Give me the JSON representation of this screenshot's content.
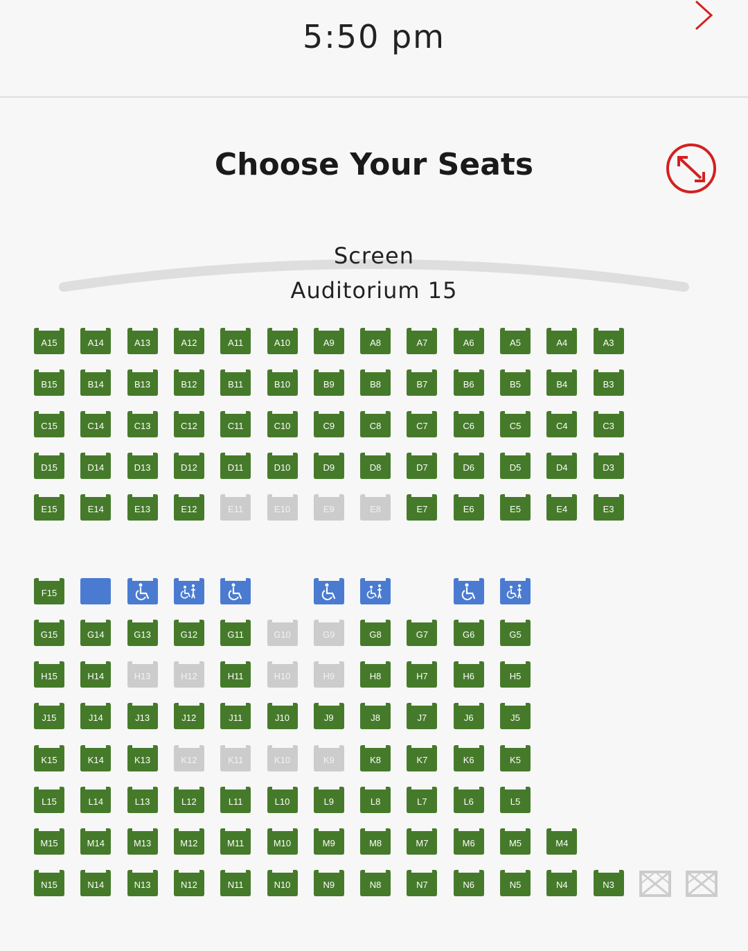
{
  "header": {
    "time": "5:50 pm",
    "next_icon": "chevron-right-icon"
  },
  "page": {
    "title": "Choose Your Seats",
    "expand_icon": "expand-icon",
    "screen_label": "Screen",
    "auditorium": "Auditorium 15"
  },
  "colors": {
    "available": "#457a2a",
    "unavailable": "#cccccc",
    "accessible": "#4a7bd0",
    "accent": "#d42020"
  },
  "rows": [
    {
      "row": "A",
      "seats": [
        {
          "label": "A15",
          "status": "available"
        },
        {
          "label": "A14",
          "status": "available"
        },
        {
          "label": "A13",
          "status": "available"
        },
        {
          "label": "A12",
          "status": "available"
        },
        {
          "label": "A11",
          "status": "available"
        },
        {
          "label": "A10",
          "status": "available"
        },
        {
          "label": "A9",
          "status": "available"
        },
        {
          "label": "A8",
          "status": "available"
        },
        {
          "label": "A7",
          "status": "available"
        },
        {
          "label": "A6",
          "status": "available"
        },
        {
          "label": "A5",
          "status": "available"
        },
        {
          "label": "A4",
          "status": "available"
        },
        {
          "label": "A3",
          "status": "available"
        }
      ]
    },
    {
      "row": "B",
      "seats": [
        {
          "label": "B15",
          "status": "available"
        },
        {
          "label": "B14",
          "status": "available"
        },
        {
          "label": "B13",
          "status": "available"
        },
        {
          "label": "B12",
          "status": "available"
        },
        {
          "label": "B11",
          "status": "available"
        },
        {
          "label": "B10",
          "status": "available"
        },
        {
          "label": "B9",
          "status": "available"
        },
        {
          "label": "B8",
          "status": "available"
        },
        {
          "label": "B7",
          "status": "available"
        },
        {
          "label": "B6",
          "status": "available"
        },
        {
          "label": "B5",
          "status": "available"
        },
        {
          "label": "B4",
          "status": "available"
        },
        {
          "label": "B3",
          "status": "available"
        }
      ]
    },
    {
      "row": "C",
      "seats": [
        {
          "label": "C15",
          "status": "available"
        },
        {
          "label": "C14",
          "status": "available"
        },
        {
          "label": "C13",
          "status": "available"
        },
        {
          "label": "C12",
          "status": "available"
        },
        {
          "label": "C11",
          "status": "available"
        },
        {
          "label": "C10",
          "status": "available"
        },
        {
          "label": "C9",
          "status": "available"
        },
        {
          "label": "C8",
          "status": "available"
        },
        {
          "label": "C7",
          "status": "available"
        },
        {
          "label": "C6",
          "status": "available"
        },
        {
          "label": "C5",
          "status": "available"
        },
        {
          "label": "C4",
          "status": "available"
        },
        {
          "label": "C3",
          "status": "available"
        }
      ]
    },
    {
      "row": "D",
      "seats": [
        {
          "label": "D15",
          "status": "available"
        },
        {
          "label": "D14",
          "status": "available"
        },
        {
          "label": "D13",
          "status": "available"
        },
        {
          "label": "D12",
          "status": "available"
        },
        {
          "label": "D11",
          "status": "available"
        },
        {
          "label": "D10",
          "status": "available"
        },
        {
          "label": "D9",
          "status": "available"
        },
        {
          "label": "D8",
          "status": "available"
        },
        {
          "label": "D7",
          "status": "available"
        },
        {
          "label": "D6",
          "status": "available"
        },
        {
          "label": "D5",
          "status": "available"
        },
        {
          "label": "D4",
          "status": "available"
        },
        {
          "label": "D3",
          "status": "available"
        }
      ]
    },
    {
      "row": "E",
      "seats": [
        {
          "label": "E15",
          "status": "available"
        },
        {
          "label": "E14",
          "status": "available"
        },
        {
          "label": "E13",
          "status": "available"
        },
        {
          "label": "E12",
          "status": "available"
        },
        {
          "label": "E11",
          "status": "unavailable"
        },
        {
          "label": "E10",
          "status": "unavailable"
        },
        {
          "label": "E9",
          "status": "unavailable"
        },
        {
          "label": "E8",
          "status": "unavailable"
        },
        {
          "label": "E7",
          "status": "available"
        },
        {
          "label": "E6",
          "status": "available"
        },
        {
          "label": "E5",
          "status": "available"
        },
        {
          "label": "E4",
          "status": "available"
        },
        {
          "label": "E3",
          "status": "available"
        }
      ]
    },
    {
      "row": "F",
      "seats": [
        {
          "label": "F15",
          "status": "available"
        },
        {
          "label": "",
          "status": "accessible-blank"
        },
        {
          "label": "",
          "status": "wheelchair"
        },
        {
          "label": "",
          "status": "companion"
        },
        {
          "label": "",
          "status": "wheelchair"
        },
        null,
        {
          "label": "",
          "status": "wheelchair"
        },
        {
          "label": "",
          "status": "companion"
        },
        null,
        {
          "label": "",
          "status": "wheelchair"
        },
        {
          "label": "",
          "status": "companion"
        }
      ]
    },
    {
      "row": "G",
      "seats": [
        {
          "label": "G15",
          "status": "available"
        },
        {
          "label": "G14",
          "status": "available"
        },
        {
          "label": "G13",
          "status": "available"
        },
        {
          "label": "G12",
          "status": "available"
        },
        {
          "label": "G11",
          "status": "available"
        },
        {
          "label": "G10",
          "status": "unavailable"
        },
        {
          "label": "G9",
          "status": "unavailable"
        },
        {
          "label": "G8",
          "status": "available"
        },
        {
          "label": "G7",
          "status": "available"
        },
        {
          "label": "G6",
          "status": "available"
        },
        {
          "label": "G5",
          "status": "available"
        }
      ]
    },
    {
      "row": "H",
      "seats": [
        {
          "label": "H15",
          "status": "available"
        },
        {
          "label": "H14",
          "status": "available"
        },
        {
          "label": "H13",
          "status": "unavailable"
        },
        {
          "label": "H12",
          "status": "unavailable"
        },
        {
          "label": "H11",
          "status": "available"
        },
        {
          "label": "H10",
          "status": "unavailable"
        },
        {
          "label": "H9",
          "status": "unavailable"
        },
        {
          "label": "H8",
          "status": "available"
        },
        {
          "label": "H7",
          "status": "available"
        },
        {
          "label": "H6",
          "status": "available"
        },
        {
          "label": "H5",
          "status": "available"
        }
      ]
    },
    {
      "row": "J",
      "seats": [
        {
          "label": "J15",
          "status": "available"
        },
        {
          "label": "J14",
          "status": "available"
        },
        {
          "label": "J13",
          "status": "available"
        },
        {
          "label": "J12",
          "status": "available"
        },
        {
          "label": "J11",
          "status": "available"
        },
        {
          "label": "J10",
          "status": "available"
        },
        {
          "label": "J9",
          "status": "available"
        },
        {
          "label": "J8",
          "status": "available"
        },
        {
          "label": "J7",
          "status": "available"
        },
        {
          "label": "J6",
          "status": "available"
        },
        {
          "label": "J5",
          "status": "available"
        }
      ]
    },
    {
      "row": "K",
      "seats": [
        {
          "label": "K15",
          "status": "available"
        },
        {
          "label": "K14",
          "status": "available"
        },
        {
          "label": "K13",
          "status": "available"
        },
        {
          "label": "K12",
          "status": "unavailable"
        },
        {
          "label": "K11",
          "status": "unavailable"
        },
        {
          "label": "K10",
          "status": "unavailable"
        },
        {
          "label": "K9",
          "status": "unavailable"
        },
        {
          "label": "K8",
          "status": "available"
        },
        {
          "label": "K7",
          "status": "available"
        },
        {
          "label": "K6",
          "status": "available"
        },
        {
          "label": "K5",
          "status": "available"
        }
      ]
    },
    {
      "row": "L",
      "seats": [
        {
          "label": "L15",
          "status": "available"
        },
        {
          "label": "L14",
          "status": "available"
        },
        {
          "label": "L13",
          "status": "available"
        },
        {
          "label": "L12",
          "status": "available"
        },
        {
          "label": "L11",
          "status": "available"
        },
        {
          "label": "L10",
          "status": "available"
        },
        {
          "label": "L9",
          "status": "available"
        },
        {
          "label": "L8",
          "status": "available"
        },
        {
          "label": "L7",
          "status": "available"
        },
        {
          "label": "L6",
          "status": "available"
        },
        {
          "label": "L5",
          "status": "available"
        }
      ]
    },
    {
      "row": "M",
      "seats": [
        {
          "label": "M15",
          "status": "available"
        },
        {
          "label": "M14",
          "status": "available"
        },
        {
          "label": "M13",
          "status": "available"
        },
        {
          "label": "M12",
          "status": "available"
        },
        {
          "label": "M11",
          "status": "available"
        },
        {
          "label": "M10",
          "status": "available"
        },
        {
          "label": "M9",
          "status": "available"
        },
        {
          "label": "M8",
          "status": "available"
        },
        {
          "label": "M7",
          "status": "available"
        },
        {
          "label": "M6",
          "status": "available"
        },
        {
          "label": "M5",
          "status": "available"
        },
        {
          "label": "M4",
          "status": "available"
        }
      ]
    },
    {
      "row": "N",
      "seats": [
        {
          "label": "N15",
          "status": "available"
        },
        {
          "label": "N14",
          "status": "available"
        },
        {
          "label": "N13",
          "status": "available"
        },
        {
          "label": "N12",
          "status": "available"
        },
        {
          "label": "N11",
          "status": "available"
        },
        {
          "label": "N10",
          "status": "available"
        },
        {
          "label": "N9",
          "status": "available"
        },
        {
          "label": "N8",
          "status": "available"
        },
        {
          "label": "N7",
          "status": "available"
        },
        {
          "label": "N6",
          "status": "available"
        },
        {
          "label": "N5",
          "status": "available"
        },
        {
          "label": "N4",
          "status": "available"
        },
        {
          "label": "N3",
          "status": "available"
        },
        {
          "label": "",
          "status": "blocked"
        },
        {
          "label": "",
          "status": "blocked"
        }
      ]
    }
  ]
}
